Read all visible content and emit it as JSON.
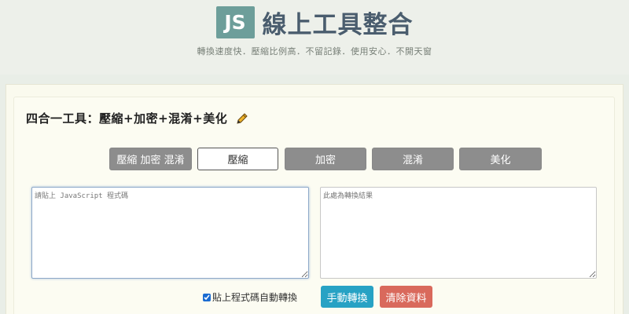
{
  "header": {
    "logo_text": "JS",
    "title": "線上工具整合",
    "tagline": "轉換速度快．壓縮比例高．不留記錄．使用安心．不開天窗"
  },
  "tool": {
    "title": "四合一工具：壓縮+加密+混淆+美化",
    "edit_icon": "pencil-icon"
  },
  "tabs": [
    {
      "label": "壓縮 加密 混淆",
      "active": false
    },
    {
      "label": "壓縮",
      "active": true
    },
    {
      "label": "加密",
      "active": false
    },
    {
      "label": "混淆",
      "active": false
    },
    {
      "label": "美化",
      "active": false
    }
  ],
  "input": {
    "placeholder": "請貼上 JavaScript 程式碼",
    "value": ""
  },
  "output": {
    "placeholder": "此處為轉換結果",
    "value": ""
  },
  "auto_convert": {
    "label": "貼上程式碼自動轉換",
    "checked": true
  },
  "buttons": {
    "convert": "手動轉換",
    "clear": "清除資料"
  },
  "colors": {
    "logo_bg": "#6d9e9a",
    "title": "#4a5d6e",
    "tab_gray": "#8d8d8d",
    "convert_btn": "#27a2c4",
    "clear_btn": "#d9695c"
  }
}
